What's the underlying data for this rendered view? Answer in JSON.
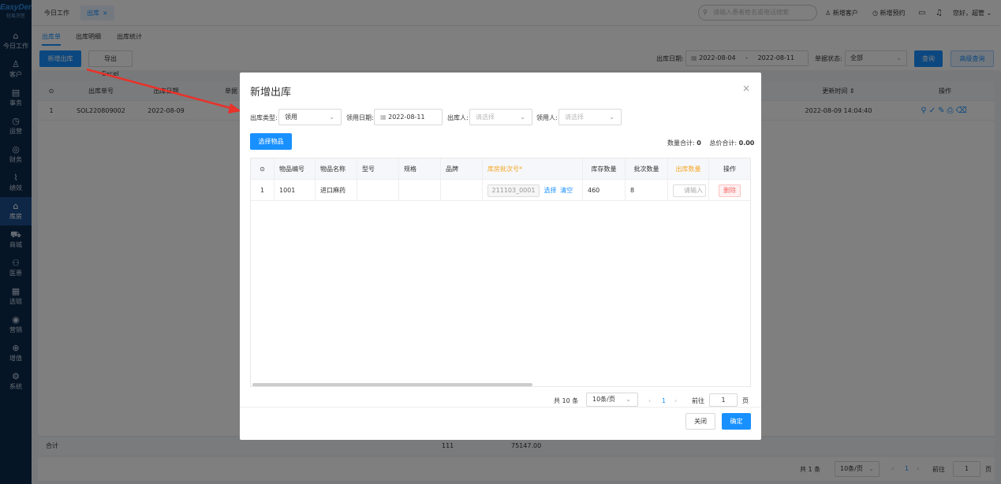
{
  "brand": {
    "name": "EasyDent",
    "sub": "轻易牙医"
  },
  "sidebar": {
    "items": [
      {
        "label": "今日工作",
        "icon": "home-icon",
        "glyph": "⌂"
      },
      {
        "label": "客户",
        "icon": "user-icon",
        "glyph": "♙"
      },
      {
        "label": "事务",
        "icon": "clipboard-icon",
        "glyph": "▤"
      },
      {
        "label": "运营",
        "icon": "clock-icon",
        "glyph": "◷"
      },
      {
        "label": "财务",
        "icon": "money-icon",
        "glyph": "◎"
      },
      {
        "label": "绩效",
        "icon": "chart-icon",
        "glyph": "⌇"
      },
      {
        "label": "库房",
        "icon": "warehouse-icon",
        "glyph": "⌂"
      },
      {
        "label": "商城",
        "icon": "cart-icon",
        "glyph": "⛟"
      },
      {
        "label": "医患",
        "icon": "people-icon",
        "glyph": "⚇"
      },
      {
        "label": "选链",
        "icon": "grid-icon",
        "glyph": "▦"
      },
      {
        "label": "营销",
        "icon": "megaphone-icon",
        "glyph": "◉"
      },
      {
        "label": "增值",
        "icon": "gift-icon",
        "glyph": "⊕"
      },
      {
        "label": "系统",
        "icon": "gear-icon",
        "glyph": "⚙"
      }
    ],
    "active_index": 6
  },
  "topbar": {
    "tabs": [
      {
        "label": "今日工作"
      },
      {
        "label": "出库",
        "close": "×"
      }
    ],
    "search_placeholder": "请输入患者姓名或电话搜索",
    "new_customer": "新增客户",
    "new_appointment": "新增预约",
    "greeting": "您好，超管"
  },
  "subtabs": [
    "出库单",
    "出库明细",
    "出库统计"
  ],
  "toolbar": {
    "add_btn": "新增出库",
    "export_btn": "导出Excel",
    "date_label": "出库日期:",
    "date_start": "2022-08-04",
    "date_sep": "-",
    "date_end": "2022-08-11",
    "status_label": "单据状态:",
    "status_value": "全部",
    "query_btn": "查询",
    "adv_query_btn": "高级查询"
  },
  "bg_table": {
    "headers": [
      "出库单号",
      "出库日期",
      "单据",
      "更新时间 ⇕",
      "操作"
    ],
    "row": {
      "index": "1",
      "no": "SOL220809002",
      "date": "2022-08-09",
      "updated": "2022-08-09 14:04:40"
    },
    "sum_label": "合计",
    "sum_qty": "111",
    "sum_amount": "75147.00",
    "pager": {
      "total": "共 1 条",
      "size": "10条/页",
      "page": "1",
      "goto": "前往",
      "goto_val": "1",
      "page_unit": "页"
    }
  },
  "modal": {
    "title": "新增出库",
    "close": "×",
    "type_label": "出库类型:",
    "type_value": "领用",
    "date_label": "领用日期:",
    "date_value": "2022-08-11",
    "out_person_label": "出库人:",
    "out_person_ph": "请选择",
    "recv_person_label": "领用人:",
    "recv_person_ph": "请选择",
    "select_btn": "选择物品",
    "qty_total_label": "数量合计:",
    "qty_total": "0",
    "price_total_label": "总价合计:",
    "price_total": "0.00",
    "table": {
      "headers": [
        "物品编号",
        "物品名称",
        "型号",
        "规格",
        "品牌",
        "库房批次号*",
        "库存数量",
        "批次数量",
        "出库数量",
        "操作"
      ],
      "rows": [
        {
          "index": "1",
          "code": "1001",
          "name": "进口麻药",
          "model": "",
          "spec": "",
          "brand": "",
          "batch": "211103_0001",
          "select": "选择",
          "clear": "清空",
          "stock": "460",
          "batch_qty": "8",
          "out_qty_ph": "请输入",
          "delete": "删除"
        }
      ]
    },
    "pager": {
      "total": "共 10 条",
      "size": "10条/页",
      "page": "1",
      "goto": "前往",
      "goto_val": "1",
      "page_unit": "页"
    },
    "cancel_btn": "关闭",
    "ok_btn": "确定"
  },
  "colors": {
    "primary": "#1890ff",
    "sidebar": "#0d2a4d",
    "required": "#f5a623",
    "danger": "#f56c6c",
    "arrow": "#e8322a"
  }
}
